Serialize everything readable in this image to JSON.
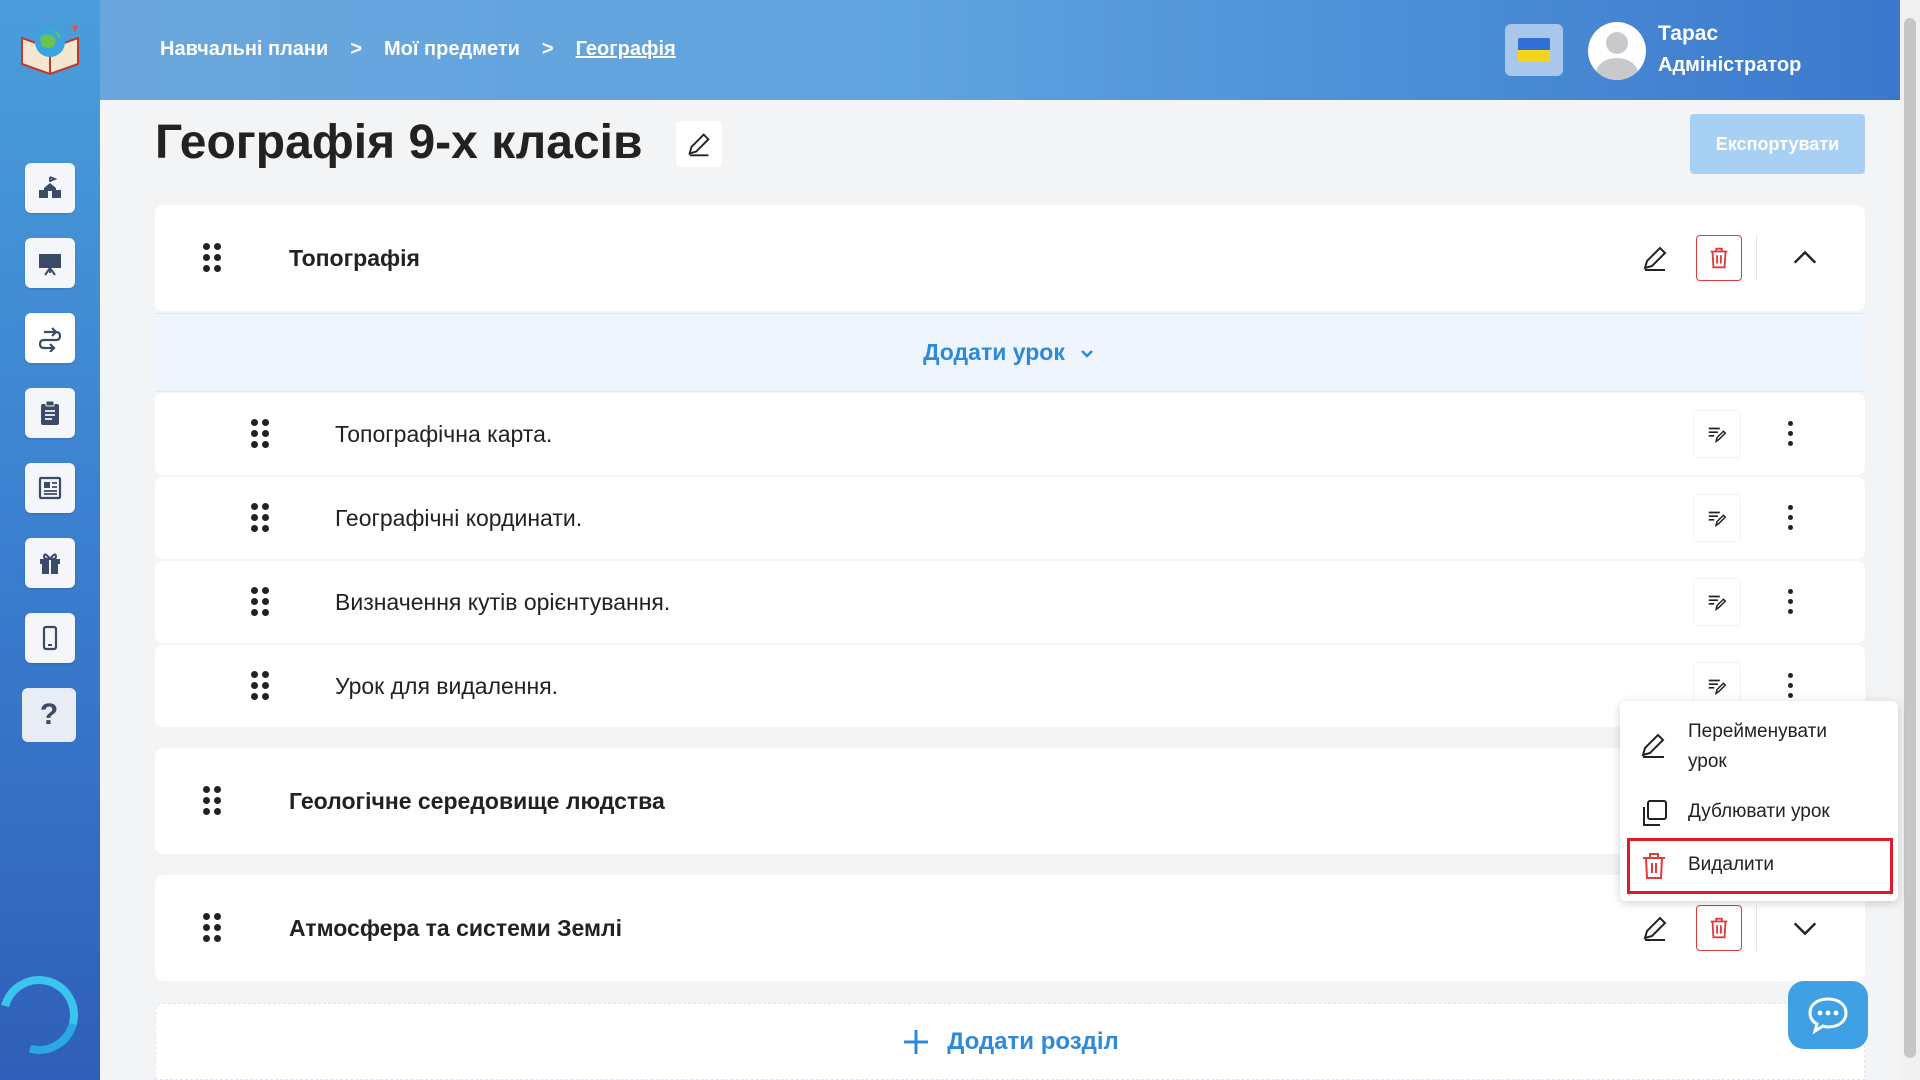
{
  "breadcrumb": {
    "items": [
      "Навчальні плани",
      "Мої предмети",
      "Географія"
    ],
    "separator": ">"
  },
  "user": {
    "name": "Тарас",
    "role": "Адміністратор"
  },
  "page": {
    "title": "Географія 9-х класів",
    "export_label": "Експортувати"
  },
  "sections": [
    {
      "title": "Топографія",
      "expanded": true,
      "add_lesson_label": "Додати урок",
      "lessons": [
        {
          "title": "Топографічна карта."
        },
        {
          "title": "Географічні кординати."
        },
        {
          "title": "Визначення кутів орієнтування."
        },
        {
          "title": "Урок для видалення."
        }
      ]
    },
    {
      "title": "Геологічне середовище людства",
      "expanded": false
    },
    {
      "title": "Атмосфера та системи Землі",
      "expanded": false
    }
  ],
  "add_section_label": "Додати розділ",
  "context_menu": {
    "rename_line1": "Перейменувати",
    "rename_line2": "урок",
    "duplicate": "Дублювати урок",
    "delete": "Видалити"
  },
  "colors": {
    "accent": "#2d8ad9",
    "danger": "#e03a3a",
    "highlight": "#e3192b",
    "sidebar": "#3b7fcf"
  }
}
